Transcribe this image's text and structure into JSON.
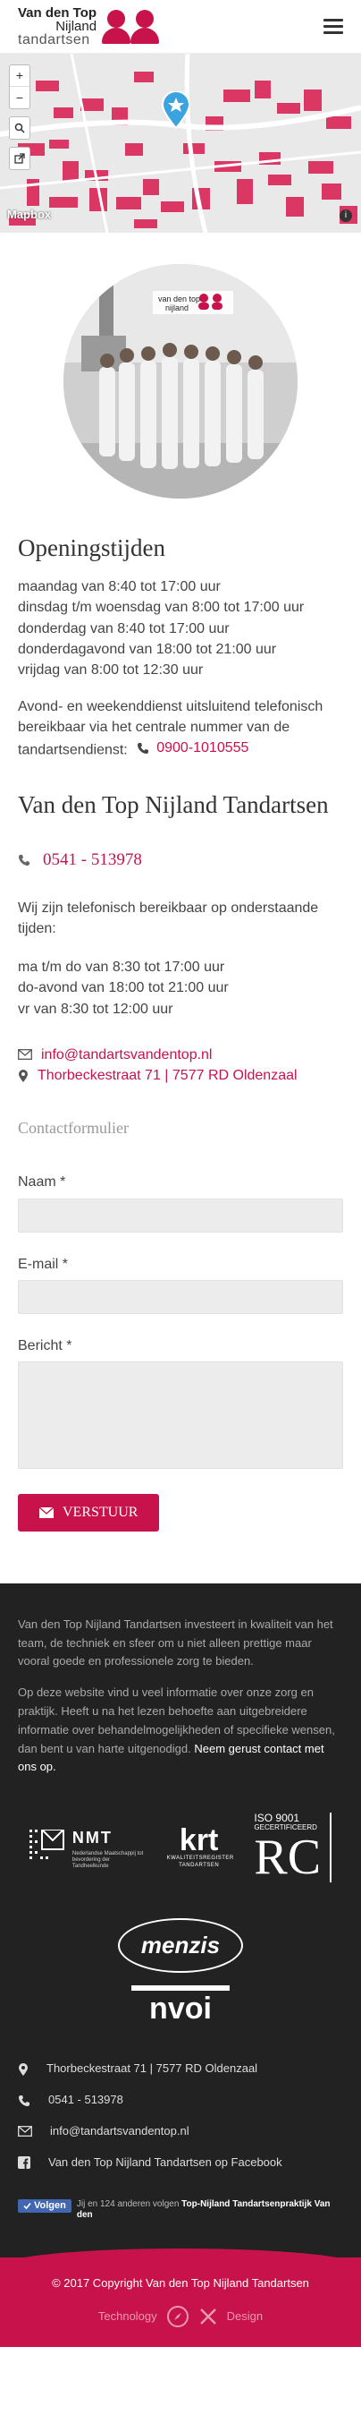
{
  "header": {
    "logo_line1": "Van den Top",
    "logo_line2": "Nijland",
    "logo_line3": "tandartsen"
  },
  "map": {
    "zoom_in": "+",
    "zoom_out": "−",
    "attribution": "Mapbox",
    "info": "i"
  },
  "hours": {
    "title": "Openingstijden",
    "lines": [
      "maandag van 8:40 tot 17:00 uur",
      "dinsdag t/m woensdag van 8:00 tot 17:00 uur",
      "donderdag van 8:40 tot 17:00 uur",
      "donderdagavond van 18:00 tot 21:00 uur",
      "vrijdag van 8:00 tot 12:30 uur"
    ],
    "emergency_text": "Avond- en weekenddienst uitsluitend telefonisch bereikbaar via het centrale nummer van de tandartsendienst:",
    "emergency_phone": "0900-1010555"
  },
  "practice": {
    "title": "Van den Top Nijland Tandartsen",
    "phone": "0541 - 513978",
    "intro": "Wij zijn telefonisch bereikbaar op onderstaande tijden:",
    "phone_hours": [
      "ma t/m do van 8:30 tot 17:00 uur",
      "do-avond van 18:00 tot 21:00 uur",
      "vr van 8:30 tot 12:00 uur"
    ],
    "email": "info@tandartsvandentop.nl",
    "address": "Thorbeckestraat 71 | 7577 RD Oldenzaal"
  },
  "form": {
    "title": "Contactformulier",
    "name_label": "Naam *",
    "email_label": "E-mail *",
    "message_label": "Bericht *",
    "submit": "VERSTUUR"
  },
  "footer": {
    "about": "Van den Top Nijland Tandartsen investeert in kwaliteit van het team, de techniek en sfeer om u niet alleen prettige maar vooral goede en professionele zorg te bieden.",
    "info_text": "Op deze website vind u veel informatie over onze zorg en praktijk. Heeft u na het lezen behoefte aan uitgebreidere informatie over behandelmogelijkheden of specifieke wensen, dan bent u van harte uitgenodigd.",
    "info_link": "Neem gerust contact met ons op.",
    "logos": {
      "nmt": "NMT",
      "nmt_sub": "Nederlandse Maatschappij tot bevordering der Tandheelkunde",
      "krt": "krt",
      "krt_sub": "KWALITEITSREGISTER TANDARTSEN",
      "iso": "ISO 9001",
      "iso_sub": "GECERTIFICEERD",
      "iso_mark": "RC",
      "menzis": "menzis",
      "nvoi": "nvoi"
    },
    "address": "Thorbeckestraat 71 | 7577 RD Oldenzaal",
    "phone": "0541 - 513978",
    "email": "info@tandartsvandentop.nl",
    "facebook": "Van den Top Nijland Tandartsen op Facebook",
    "follow_button": "Volgen",
    "follow_text_pre": "Jij en 124 anderen volgen",
    "follow_page": "Top-Nijland Tandartsenpraktijk Van den",
    "copyright": "© 2017 Copyright Van den Top Nijland Tandartsen",
    "credit_left": "Technology",
    "credit_right": "Design"
  },
  "colors": {
    "brand": "#c8124b",
    "footer_bg": "#222222"
  }
}
